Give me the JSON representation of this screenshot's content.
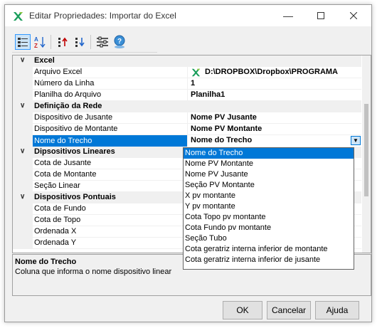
{
  "window": {
    "title": "Editar Propriedades: Importar do Excel"
  },
  "colors": {
    "accent": "#0078d7",
    "excel_green": "#21a366",
    "category_bg": "#f0f0f0"
  },
  "toolbar": {
    "icons": [
      "categorized-icon",
      "alphabetical-icon",
      "move-up-icon",
      "move-down-icon",
      "settings-sliders-icon",
      "help-globe-icon"
    ]
  },
  "grid": {
    "categories": [
      {
        "label": "Excel",
        "rows": [
          {
            "name": "Arquivo Excel",
            "value": "D:\\DROPBOX\\Dropbox\\PROGRAMA"
          },
          {
            "name": "Número da Linha",
            "value": "1"
          },
          {
            "name": "Planilha do Arquivo",
            "value": "Planilha1"
          }
        ]
      },
      {
        "label": "Definição da Rede",
        "rows": [
          {
            "name": "Dispositivo de Jusante",
            "value": "Nome PV Jusante"
          },
          {
            "name": "Dispositivo de Montante",
            "value": "Nome PV Montante"
          },
          {
            "name": "Nome do Trecho",
            "value": "Nome do Trecho"
          }
        ]
      },
      {
        "label": "Dipsositivos Lineares",
        "rows": [
          {
            "name": "Cota de Jusante",
            "value": ""
          },
          {
            "name": "Cota de Montante",
            "value": ""
          },
          {
            "name": "Seção Linear",
            "value": ""
          }
        ]
      },
      {
        "label": "Dispositivos Pontuais",
        "rows": [
          {
            "name": "Cota de Fundo",
            "value": ""
          },
          {
            "name": "Cota de Topo",
            "value": ""
          },
          {
            "name": "Ordenada X",
            "value": ""
          },
          {
            "name": "Ordenada Y",
            "value": ""
          }
        ]
      }
    ]
  },
  "dropdown": {
    "options": [
      "Nome do Trecho",
      "Nome PV Montante",
      "Nome PV Jusante",
      "Seção PV Montante",
      "X pv montante",
      "Y pv montante",
      "Cota Topo pv montante",
      "Cota Fundo pv montante",
      "Seção Tubo",
      "Cota geratriz interna inferior de montante",
      "Cota geratriz interna inferior de jusante"
    ],
    "selected": "Nome do Trecho"
  },
  "help": {
    "title": "Nome do Trecho",
    "description": "Coluna que informa o nome dispositivo linear"
  },
  "buttons": {
    "ok": "OK",
    "cancel": "Cancelar",
    "help": "Ajuda"
  }
}
